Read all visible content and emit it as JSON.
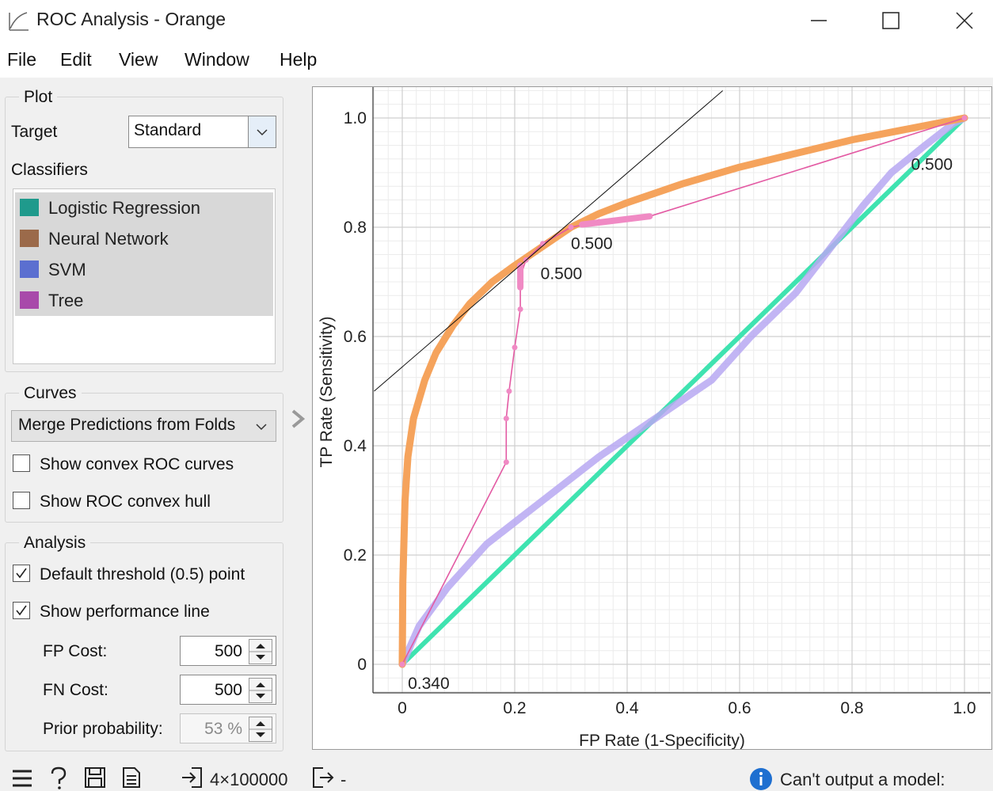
{
  "window": {
    "title": "ROC Analysis - Orange"
  },
  "menu": [
    "File",
    "Edit",
    "View",
    "Window",
    "Help"
  ],
  "plot_box": {
    "title": "Plot",
    "target_label": "Target",
    "target_value": "Standard",
    "classifiers_label": "Classifiers",
    "classifiers": [
      {
        "label": "Logistic Regression",
        "color": "#1f9a8c"
      },
      {
        "label": "Neural Network",
        "color": "#9b6a4a"
      },
      {
        "label": "SVM",
        "color": "#5b6fd0"
      },
      {
        "label": "Tree",
        "color": "#a84aaa"
      }
    ]
  },
  "curves_box": {
    "title": "Curves",
    "mode": "Merge Predictions from Folds",
    "show_convex_label": "Show convex ROC curves",
    "show_convex_checked": false,
    "show_hull_label": "Show ROC convex hull",
    "show_hull_checked": false
  },
  "analysis_box": {
    "title": "Analysis",
    "default_threshold_label": "Default threshold (0.5) point",
    "default_threshold_checked": true,
    "perf_line_label": "Show performance line",
    "perf_line_checked": true,
    "fp_cost_label": "FP Cost:",
    "fp_cost": "500",
    "fn_cost_label": "FN Cost:",
    "fn_cost": "500",
    "prior_label": "Prior probability:",
    "prior": "53 %"
  },
  "status": {
    "data_shape": "4×100000",
    "output": "-",
    "message": "Can't output a model:"
  },
  "colors": {
    "orange_curve": "#f5a35c",
    "pink_curve": "#e35aa3",
    "lavender_curve": "#b7a8f2",
    "teal_curve": "#3fe3b0"
  },
  "chart_data": {
    "type": "line",
    "xlabel": "FP Rate (1-Specificity)",
    "ylabel": "TP Rate (Sensitivity)",
    "xlim": [
      0,
      1
    ],
    "ylim": [
      0,
      1
    ],
    "xticks": [
      "0",
      "0.2",
      "0.4",
      "0.6",
      "0.8",
      "1.0"
    ],
    "yticks": [
      "0",
      "0.2",
      "0.4",
      "0.6",
      "0.8",
      "1.0"
    ],
    "grid": true,
    "series": [
      {
        "color": "#f5a35c",
        "x": [
          0,
          0.001,
          0.005,
          0.01,
          0.02,
          0.04,
          0.06,
          0.09,
          0.12,
          0.16,
          0.2,
          0.25,
          0.3,
          0.35,
          0.4,
          0.5,
          0.6,
          0.7,
          0.8,
          0.9,
          1.0
        ],
        "y": [
          0,
          0.15,
          0.3,
          0.38,
          0.45,
          0.52,
          0.57,
          0.62,
          0.66,
          0.7,
          0.73,
          0.765,
          0.8,
          0.825,
          0.845,
          0.88,
          0.91,
          0.935,
          0.96,
          0.98,
          1.0
        ]
      },
      {
        "color": "#e35aa3",
        "x": [
          0,
          0.185,
          0.185,
          0.19,
          0.2,
          0.21,
          0.21,
          0.22,
          0.25,
          0.3,
          0.35,
          0.44,
          1.0
        ],
        "y": [
          0,
          0.37,
          0.45,
          0.5,
          0.58,
          0.65,
          0.71,
          0.74,
          0.77,
          0.8,
          0.81,
          0.82,
          1.0
        ]
      },
      {
        "color": "#b7a8f2",
        "x": [
          0,
          0.03,
          0.08,
          0.15,
          0.25,
          0.35,
          0.45,
          0.55,
          0.62,
          0.7,
          0.76,
          0.82,
          0.87,
          0.93,
          0.98,
          1.0
        ],
        "y": [
          0,
          0.07,
          0.14,
          0.22,
          0.3,
          0.38,
          0.45,
          0.52,
          0.6,
          0.68,
          0.76,
          0.84,
          0.9,
          0.95,
          0.99,
          1.0
        ]
      },
      {
        "color": "#3fe3b0",
        "x": [
          0,
          1.0
        ],
        "y": [
          0,
          1.0
        ]
      }
    ],
    "performance_line": {
      "x": [
        -0.05,
        0.57
      ],
      "y": [
        0.5,
        1.05
      ]
    },
    "annotations": [
      {
        "text": "0.500",
        "x": 0.3,
        "y": 0.76
      },
      {
        "text": "0.500",
        "x": 0.246,
        "y": 0.705
      },
      {
        "text": "0.500",
        "x": 0.905,
        "y": 0.905
      },
      {
        "text": "0.340",
        "x": 0.01,
        "y": -0.045
      }
    ]
  }
}
